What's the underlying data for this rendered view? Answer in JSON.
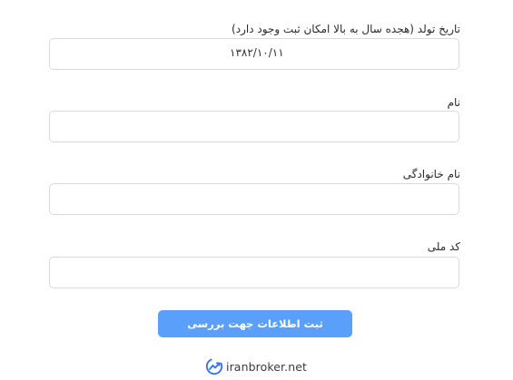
{
  "form": {
    "birth_date": {
      "label": "تاریخ تولد (هجده سال به بالا امکان ثبت وجود دارد)",
      "value": "۱۳۸۲/۱۰/۱۱"
    },
    "first_name": {
      "label": "نام",
      "value": ""
    },
    "last_name": {
      "label": "نام خانوادگی",
      "value": ""
    },
    "national_code": {
      "label": "کد ملی",
      "value": ""
    },
    "submit_label": "ثبت اطلاعات جهت بررسی"
  },
  "brand": {
    "text": "iranbroker.net",
    "icon": "iranbroker-logo-icon",
    "color": "#2d6ff7"
  },
  "colors": {
    "button": "#5aa0fb",
    "field_border": "#d9d9d9"
  }
}
